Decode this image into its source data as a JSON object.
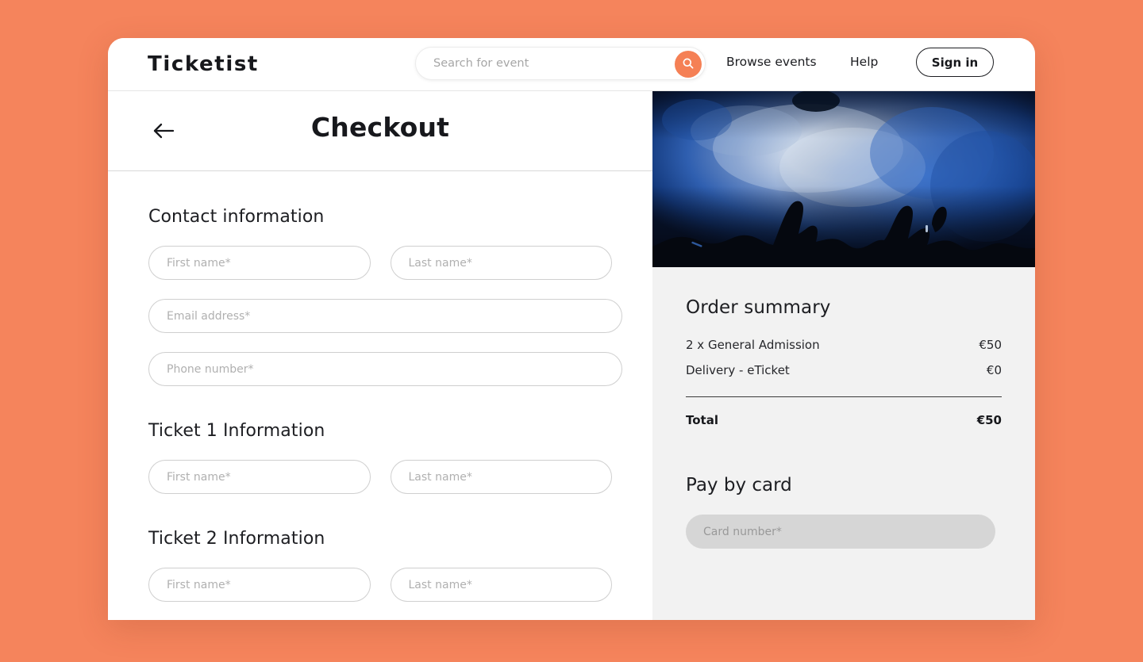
{
  "theme": {
    "page_background": "#F5845C",
    "accent": "#F58055",
    "card_background": "#FFFFFF",
    "summary_background": "#F2F2F2",
    "text_primary": "#17181C",
    "placeholder": "#B0B0B0"
  },
  "topnav": {
    "brand": "Ticketist",
    "search": {
      "placeholder": "Search for event",
      "value": "",
      "button_icon": "search-icon"
    },
    "links": [
      {
        "label": "Browse events"
      },
      {
        "label": "Help"
      }
    ],
    "signin_label": "Sign in"
  },
  "page": {
    "back_icon": "arrow-left-icon",
    "title": "Checkout"
  },
  "contact_section": {
    "title": "Contact information",
    "fields": [
      {
        "name": "first-name",
        "placeholder": "First name*",
        "value": ""
      },
      {
        "name": "last-name",
        "placeholder": "Last name*",
        "value": ""
      },
      {
        "name": "email-address",
        "placeholder": "Email address*",
        "value": ""
      },
      {
        "name": "phone-number",
        "placeholder": "Phone number*",
        "value": ""
      }
    ]
  },
  "ticket_sections": [
    {
      "title": "Ticket 1 Information",
      "fields": [
        {
          "name": "first-name",
          "placeholder": "First name*",
          "value": ""
        },
        {
          "name": "last-name",
          "placeholder": "Last name*",
          "value": ""
        }
      ]
    },
    {
      "title": "Ticket 2 Information",
      "fields": [
        {
          "name": "first-name",
          "placeholder": "First name*",
          "value": ""
        },
        {
          "name": "last-name",
          "placeholder": "Last name*",
          "value": ""
        }
      ]
    }
  ],
  "hero": {
    "alt": "concert crowd with raised hands under blue stage lights"
  },
  "order_summary": {
    "title": "Order summary",
    "lines": [
      {
        "label": "2 x General Admission",
        "amount": "€50"
      },
      {
        "label": "Delivery - eTicket",
        "amount": "€0"
      }
    ],
    "total_label": "Total",
    "total_amount": "€50"
  },
  "payment": {
    "title": "Pay by card",
    "card_number": {
      "placeholder": "Card number*",
      "value": ""
    }
  }
}
